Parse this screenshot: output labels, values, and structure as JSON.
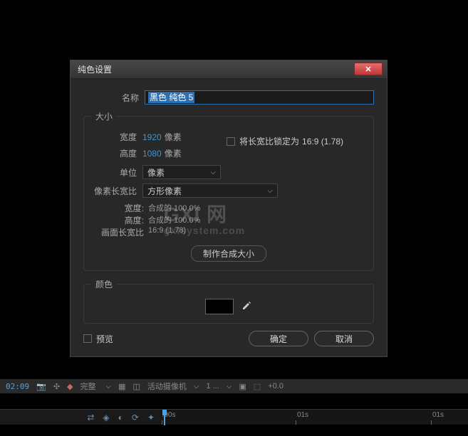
{
  "dialog": {
    "title": "纯色设置",
    "name_label": "名称",
    "name_value": "黑色 纯色 5",
    "size": {
      "legend": "大小",
      "width_label": "宽度",
      "width_value": "1920",
      "height_label": "高度",
      "height_value": "1080",
      "px_unit": "像素",
      "lock_label": "将长宽比锁定为",
      "lock_ratio": "16:9 (1.78)",
      "units_label": "单位",
      "units_value": "像素",
      "par_label": "像素长宽比",
      "par_value": "方形像素",
      "info_width_label": "宽度:",
      "info_width_value": "合成的 100.0%",
      "info_height_label": "高度:",
      "info_height_value": "合成的 100.0%",
      "frame_ar_label": "画面长宽比",
      "frame_ar_value": "16:9 (1.78)",
      "make_btn": "制作合成大小"
    },
    "color": {
      "legend": "颜色",
      "swatch": "#000000"
    },
    "preview_label": "预览",
    "ok": "确定",
    "cancel": "取消"
  },
  "toolbar": {
    "timecode": "02:09",
    "render_label": "完整",
    "camera_label": "活动摄像机",
    "view_count": "1 ...",
    "extra": "+0.0"
  },
  "timeline": {
    "ticks": [
      ":00s",
      "01s",
      "01s"
    ]
  },
  "watermark": {
    "main": "GXI 网",
    "sub": "gxlsystem.com"
  }
}
